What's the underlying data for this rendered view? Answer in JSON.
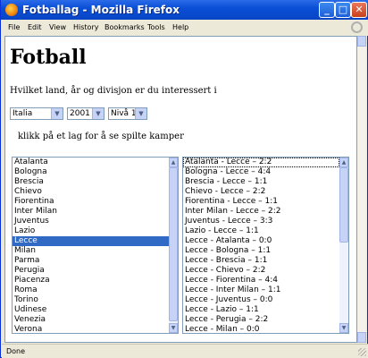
{
  "window": {
    "title": "Fotballag - Mozilla Firefox"
  },
  "menu": [
    "File",
    "Edit",
    "View",
    "History",
    "Bookmarks",
    "Tools",
    "Help"
  ],
  "page": {
    "heading": "Fotball",
    "question": "Hvilket land, år og divisjon er du interessert i",
    "hint": "klikk på et lag for å se spilte kamper"
  },
  "selects": {
    "country": "Italia",
    "year": "2001",
    "level": "Nivå 1"
  },
  "teams": {
    "selected": "Lecce",
    "items": [
      "Atalanta",
      "Bologna",
      "Brescia",
      "Chievo",
      "Fiorentina",
      "Inter Milan",
      "Juventus",
      "Lazio",
      "Lecce",
      "Milan",
      "Parma",
      "Perugia",
      "Piacenza",
      "Roma",
      "Torino",
      "Udinese",
      "Venezia",
      "Verona"
    ]
  },
  "matches": {
    "items": [
      "Atalanta - Lecce – 2:2",
      "Bologna - Lecce – 4:4",
      "Brescia - Lecce – 1:1",
      "Chievo - Lecce – 2:2",
      "Fiorentina - Lecce – 1:1",
      "Inter Milan - Lecce – 2:2",
      "Juventus - Lecce – 3:3",
      "Lazio - Lecce – 1:1",
      "Lecce - Atalanta – 0:0",
      "Lecce - Bologna – 1:1",
      "Lecce - Brescia – 1:1",
      "Lecce - Chievo – 2:2",
      "Lecce - Fiorentina – 4:4",
      "Lecce - Inter Milan – 1:1",
      "Lecce - Juventus – 0:0",
      "Lecce - Lazio – 1:1",
      "Lecce - Perugia – 2:2",
      "Lecce - Milan – 0:0"
    ]
  },
  "status": "Done"
}
